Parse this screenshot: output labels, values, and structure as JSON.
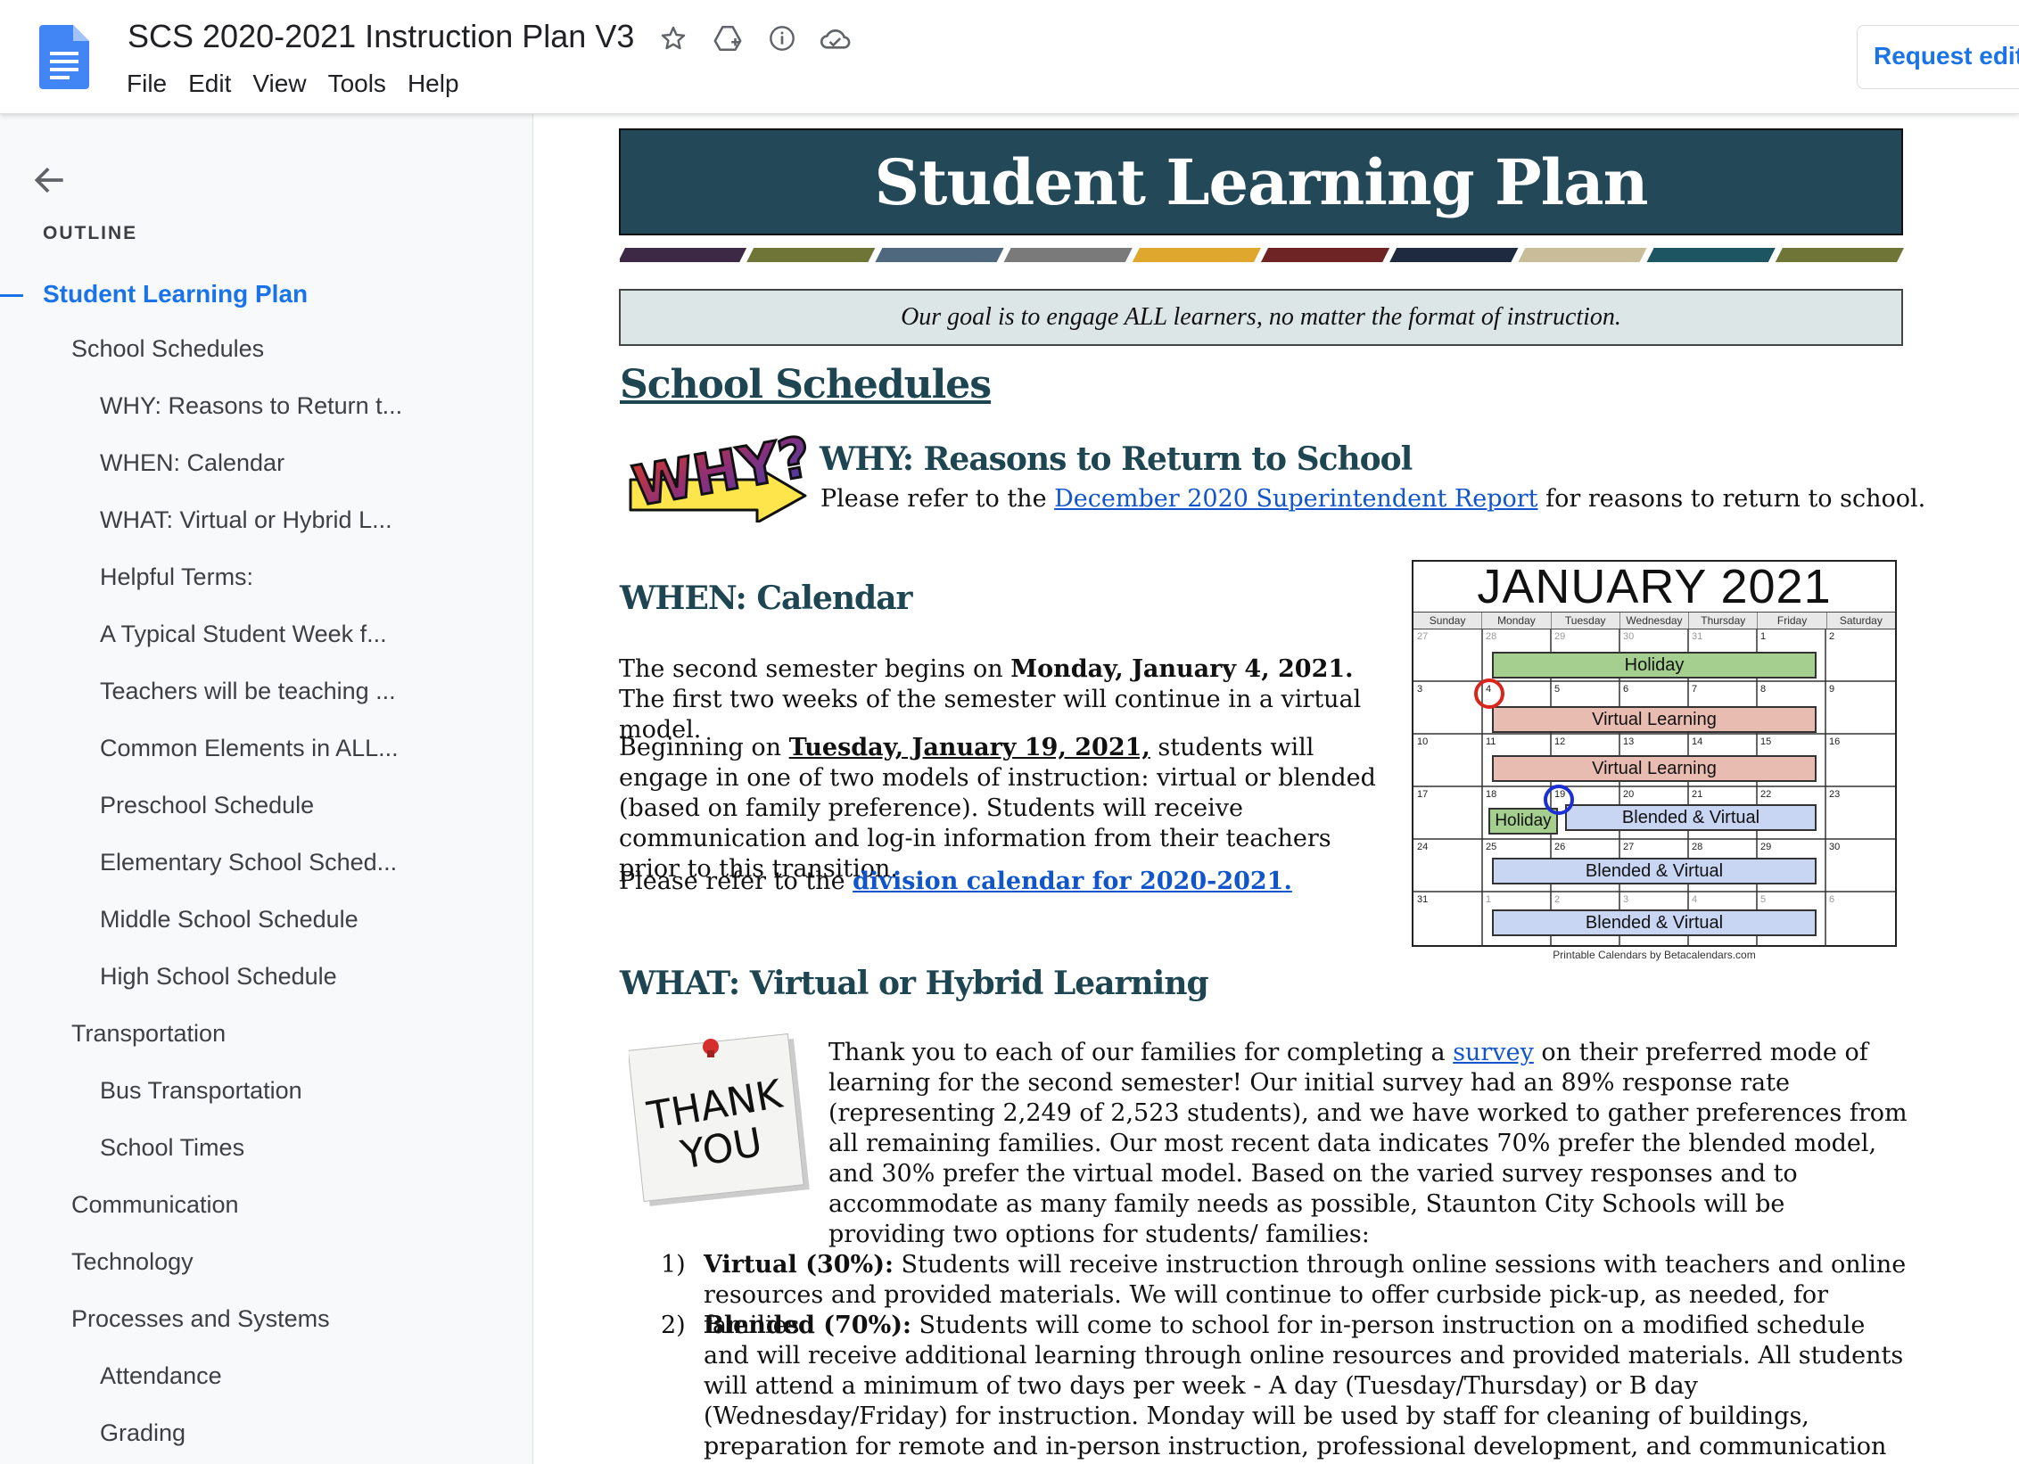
{
  "app": {
    "doc_title": "SCS 2020-2021 Instruction Plan V3",
    "menu": [
      "File",
      "Edit",
      "View",
      "Tools",
      "Help"
    ],
    "request_edit": "Request edit",
    "accent": "#1a73e8"
  },
  "outline": {
    "label": "OUTLINE",
    "items": [
      {
        "label": "Student Learning Plan",
        "level": 0,
        "active": true
      },
      {
        "label": "School Schedules",
        "level": 1
      },
      {
        "label": "WHY: Reasons to Return t...",
        "level": 2
      },
      {
        "label": "WHEN: Calendar",
        "level": 2
      },
      {
        "label": "WHAT: Virtual or Hybrid L...",
        "level": 2
      },
      {
        "label": "Helpful Terms:",
        "level": 2
      },
      {
        "label": "A Typical Student Week f...",
        "level": 2
      },
      {
        "label": "Teachers will be teaching ...",
        "level": 2
      },
      {
        "label": "Common Elements in ALL...",
        "level": 2
      },
      {
        "label": "Preschool Schedule",
        "level": 2
      },
      {
        "label": "Elementary School Sched...",
        "level": 2
      },
      {
        "label": "Middle School Schedule",
        "level": 2
      },
      {
        "label": "High School Schedule",
        "level": 2
      },
      {
        "label": "Transportation",
        "level": 1
      },
      {
        "label": "Bus Transportation",
        "level": 2
      },
      {
        "label": "School Times",
        "level": 2
      },
      {
        "label": "Communication",
        "level": 1
      },
      {
        "label": "Technology",
        "level": 1
      },
      {
        "label": "Processes and Systems",
        "level": 1
      },
      {
        "label": "Attendance",
        "level": 2
      },
      {
        "label": "Grading",
        "level": 2
      }
    ]
  },
  "document": {
    "banner_title": "Student Learning Plan",
    "stripe_colors": [
      "#3d2845",
      "#6f7437",
      "#50687e",
      "#7a7a7a",
      "#e0a72e",
      "#6e2424",
      "#1e2a40",
      "#c8bd98",
      "#1d5563",
      "#6f7437"
    ],
    "goal": "Our goal is to engage ALL learners, no matter the format of instruction.",
    "section_schedules": "School Schedules",
    "why": {
      "graphic_text": "WHY?",
      "heading": "WHY:  Reasons to Return to School",
      "pre": "Please refer to the ",
      "link": "December 2020 Superintendent Report",
      "post": " for reasons to return to school."
    },
    "when": {
      "heading": "WHEN:  Calendar",
      "p1_pre": "The second semester begins on ",
      "p1_bold": "Monday, January 4, 2021.",
      "p1_post": "  The first two weeks of the semester will continue in a virtual model.",
      "p2_pre": "Beginning on ",
      "p2_bold": "Tuesday, January 19, 2021,",
      "p2_post": " students will engage in one of two models of instruction:  virtual or blended (based on family preference).  Students will receive communication and log-in information from their teachers prior to this transition.",
      "p3_pre": "Please refer to the ",
      "p3_link": "division calendar for 2020-2021."
    },
    "calendar": {
      "title": "JANUARY 2021",
      "days": [
        "Sunday",
        "Monday",
        "Tuesday",
        "Wednesday",
        "Thursday",
        "Friday",
        "Saturday"
      ],
      "weeks": [
        [
          "27",
          "28",
          "29",
          "30",
          "31",
          "1",
          "2"
        ],
        [
          "3",
          "4",
          "5",
          "6",
          "7",
          "8",
          "9"
        ],
        [
          "10",
          "11",
          "12",
          "13",
          "14",
          "15",
          "16"
        ],
        [
          "17",
          "18",
          "19",
          "20",
          "21",
          "22",
          "23"
        ],
        [
          "24",
          "25",
          "26",
          "27",
          "28",
          "29",
          "30"
        ],
        [
          "31",
          "1",
          "2",
          "3",
          "4",
          "5",
          "6"
        ]
      ],
      "bars": {
        "holiday1": "Holiday",
        "virtual1": "Virtual Learning",
        "virtual2": "Virtual Learning",
        "holiday2": "Holiday",
        "blended1": "Blended & Virtual",
        "blended2": "Blended & Virtual",
        "blended3": "Blended & Virtual"
      },
      "credit": "Printable Calendars by Betacalendars.com"
    },
    "what": {
      "heading": "WHAT:  Virtual or Hybrid Learning",
      "sticky_line1": "THANK",
      "sticky_line2": "YOU",
      "p_pre": "Thank you to each of our families for completing a ",
      "p_link": "survey",
      "p_post": " on their preferred mode of learning for the second semester!  Our initial survey had an 89% response rate (representing 2,249 of 2,523 students), and we have worked to gather preferences from all remaining families.  Our most recent data indicates 70% prefer the blended model, and 30% prefer the virtual model. Based on the varied survey responses and to accommodate as many family needs as possible, Staunton City Schools will be providing two options for students/ families:",
      "list": [
        {
          "num": "1)",
          "bold": "Virtual (30%):",
          "text": "  Students will receive instruction through online sessions with teachers and online resources and provided materials.  We will continue to offer curbside pick-up, as needed, for families."
        },
        {
          "num": "2)",
          "bold": "Blended (70%):",
          "text": "  Students will come to school for in-person instruction on a modified schedule and will receive additional learning through online resources and provided materials.  All students will attend a minimum of two days per week - A day (Tuesday/Thursday) or B day (Wednesday/Friday) for instruction. Monday will be used by staff for cleaning of buildings, preparation for remote and in-person instruction, professional development, and communication with students/families.  The chart provides a summary of"
        }
      ]
    }
  }
}
